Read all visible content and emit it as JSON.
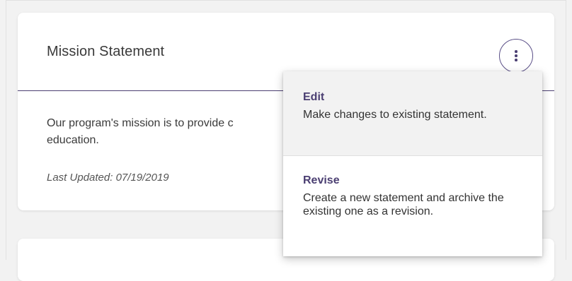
{
  "card": {
    "title": "Mission Statement",
    "body": "Our program's mission is to provide c\neducation.",
    "last_updated": "Last Updated: 07/19/2019",
    "menu_button_icon": "kebab-vertical-icon"
  },
  "menu": {
    "items": [
      {
        "label": "Edit",
        "description": "Make changes to existing statement."
      },
      {
        "label": "Revise",
        "description": "Create a new statement and archive the existing one as a revision."
      }
    ]
  },
  "colors": {
    "accent": "#4b3f72",
    "menu_hover_bg": "#f2f2f2",
    "page_bg": "#f2f2f2"
  }
}
